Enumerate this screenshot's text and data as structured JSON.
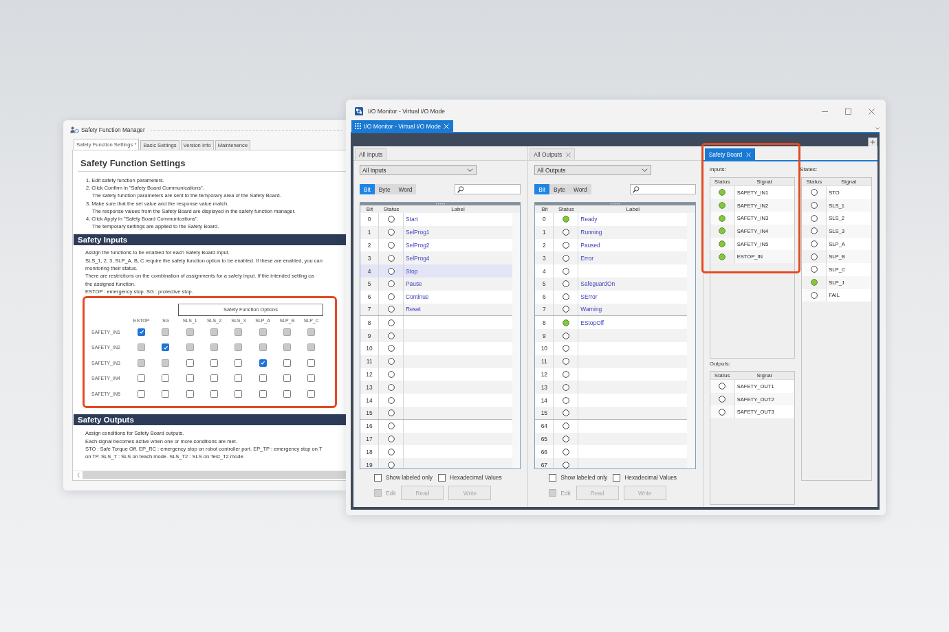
{
  "manager": {
    "title": "Safety Function Manager",
    "tabs": [
      {
        "label": "Safety Function Settings *",
        "selected": true
      },
      {
        "label": "Basic Settings",
        "selected": false
      },
      {
        "label": "Version Info",
        "selected": false
      },
      {
        "label": "Maintenence",
        "selected": false
      }
    ],
    "heading": "Safety Function Settings",
    "steps": [
      {
        "kind": "step",
        "text": "1. Edit safety function parameters."
      },
      {
        "kind": "step",
        "text": "2. Click Confirm in \"Safety Board Communications\"."
      },
      {
        "kind": "note",
        "text": "The safety function parameters are sent to the temporary area of the Safety Board."
      },
      {
        "kind": "step",
        "text": "3. Make sure that the set value and the response value match."
      },
      {
        "kind": "note",
        "text": "The response values from the Safety Board are displayed in the safety function manager."
      },
      {
        "kind": "step",
        "text": "4. Click Apply in \"Safety Board Communications\"."
      },
      {
        "kind": "note",
        "text": "The temporary settings are applied to the Safety Board."
      }
    ],
    "inputs": {
      "title": "Safety Inputs",
      "lines": [
        "Assign the functions to be enabled for each Safety Board input.",
        "SLS_1, 2, 3, SLP_A, B, C require the safety function option to be enabled. If these are enabled, you can",
        "monitoring their status.",
        "There are restrictions on the combination of assignments for a safety input. If the intended setting ca",
        "the assigned function.",
        "ESTOP : emergency stop. SG : protective stop."
      ],
      "grid": {
        "highlighted": true,
        "group_label": "Safety Function Options",
        "columns": [
          "ESTOP",
          "SG",
          "SLS_1",
          "SLS_2",
          "SLS_3",
          "SLP_A",
          "SLP_B",
          "SLP_C"
        ],
        "rows": [
          {
            "label": "SAFETY_IN1",
            "cells": [
              {
                "checked": true,
                "disabled": false
              },
              {
                "checked": false,
                "disabled": true
              },
              {
                "checked": false,
                "disabled": true
              },
              {
                "checked": false,
                "disabled": true
              },
              {
                "checked": false,
                "disabled": true
              },
              {
                "checked": false,
                "disabled": true
              },
              {
                "checked": false,
                "disabled": true
              },
              {
                "checked": false,
                "disabled": true
              }
            ]
          },
          {
            "label": "SAFETY_IN2",
            "cells": [
              {
                "checked": false,
                "disabled": true
              },
              {
                "checked": true,
                "disabled": false
              },
              {
                "checked": false,
                "disabled": true
              },
              {
                "checked": false,
                "disabled": true
              },
              {
                "checked": false,
                "disabled": true
              },
              {
                "checked": false,
                "disabled": true
              },
              {
                "checked": false,
                "disabled": true
              },
              {
                "checked": false,
                "disabled": true
              }
            ]
          },
          {
            "label": "SAFETY_IN3",
            "cells": [
              {
                "checked": false,
                "disabled": true
              },
              {
                "checked": false,
                "disabled": true
              },
              {
                "checked": false,
                "disabled": false
              },
              {
                "checked": false,
                "disabled": false
              },
              {
                "checked": false,
                "disabled": false
              },
              {
                "checked": true,
                "disabled": false
              },
              {
                "checked": false,
                "disabled": false
              },
              {
                "checked": false,
                "disabled": false
              }
            ]
          },
          {
            "label": "SAFETY_IN4",
            "cells": [
              {
                "checked": false,
                "disabled": false
              },
              {
                "checked": false,
                "disabled": false
              },
              {
                "checked": false,
                "disabled": false
              },
              {
                "checked": false,
                "disabled": false
              },
              {
                "checked": false,
                "disabled": false
              },
              {
                "checked": false,
                "disabled": false
              },
              {
                "checked": false,
                "disabled": false
              },
              {
                "checked": false,
                "disabled": false
              }
            ]
          },
          {
            "label": "SAFETY_IN5",
            "cells": [
              {
                "checked": false,
                "disabled": false
              },
              {
                "checked": false,
                "disabled": false
              },
              {
                "checked": false,
                "disabled": false
              },
              {
                "checked": false,
                "disabled": false
              },
              {
                "checked": false,
                "disabled": false
              },
              {
                "checked": false,
                "disabled": false
              },
              {
                "checked": false,
                "disabled": false
              },
              {
                "checked": false,
                "disabled": false
              }
            ]
          }
        ]
      }
    },
    "outputs": {
      "title": "Safety Outputs",
      "lines": [
        "Assign conditions for Safety Board outputs.",
        "Each signal becomes active when one or more conditions are met.",
        "STO : Safe Torque Off. EP_RC : emergency stop on robot controller port. EP_TP : emergency stop on T",
        "on TP. SLS_T : SLS on teach mode. SLS_T2 : SLS on Test_T2 mode."
      ]
    }
  },
  "monitor": {
    "title": "I/O Monitor - Virtual I/O Mode",
    "doc_tab": {
      "label": "I/O Monitor - Virtual I/O Mode",
      "selected": true
    },
    "panes": [
      {
        "kind": "io",
        "tab": {
          "label": "All Inputs",
          "selected": false,
          "closable": false
        },
        "dropdown": "All Inputs",
        "modes": [
          {
            "label": "Bit",
            "selected": true
          },
          {
            "label": "Byte",
            "selected": false
          },
          {
            "label": "Word",
            "selected": false
          }
        ],
        "columns": [
          "Bit",
          "Status",
          "Label"
        ],
        "rows": [
          {
            "bit": "0",
            "on": false,
            "label": "Start",
            "selected": false
          },
          {
            "bit": "1",
            "on": false,
            "label": "SelProg1",
            "selected": false
          },
          {
            "bit": "2",
            "on": false,
            "label": "SelProg2",
            "selected": false
          },
          {
            "bit": "3",
            "on": false,
            "label": "SelProg4",
            "selected": false
          },
          {
            "bit": "4",
            "on": false,
            "label": "Stop",
            "selected": true
          },
          {
            "bit": "5",
            "on": false,
            "label": "Pause",
            "selected": false
          },
          {
            "bit": "6",
            "on": false,
            "label": "Continue",
            "selected": false
          },
          {
            "bit": "7",
            "on": false,
            "label": "Reset",
            "selected": false
          },
          {
            "bit": "8",
            "on": false,
            "selected": false
          },
          {
            "bit": "9",
            "on": false,
            "selected": false
          },
          {
            "bit": "10",
            "on": false,
            "selected": false
          },
          {
            "bit": "11",
            "on": false,
            "selected": false
          },
          {
            "bit": "12",
            "on": false,
            "selected": false
          },
          {
            "bit": "13",
            "on": false,
            "selected": false
          },
          {
            "bit": "14",
            "on": false,
            "selected": false
          },
          {
            "bit": "15",
            "on": false,
            "selected": false
          },
          {
            "bit": "16",
            "on": false,
            "selected": false
          },
          {
            "bit": "17",
            "on": false,
            "selected": false
          },
          {
            "bit": "18",
            "on": false,
            "selected": false
          },
          {
            "bit": "19",
            "on": false,
            "selected": false
          }
        ],
        "options": [
          {
            "label": "Show labeled only",
            "checked": false
          },
          {
            "label": "Hexadecimal Values",
            "checked": false
          }
        ],
        "edit": {
          "label": "Edit",
          "checked": false,
          "disabled": true
        },
        "buttons": [
          {
            "label": "Read",
            "disabled": true
          },
          {
            "label": "Write",
            "disabled": true
          }
        ]
      },
      {
        "kind": "io",
        "tab": {
          "label": "All Outputs",
          "selected": false,
          "closable": true
        },
        "dropdown": "All Outputs",
        "modes": [
          {
            "label": "Bit",
            "selected": true
          },
          {
            "label": "Byte",
            "selected": false
          },
          {
            "label": "Word",
            "selected": false
          }
        ],
        "columns": [
          "Bit",
          "Status",
          "Label"
        ],
        "rows": [
          {
            "bit": "0",
            "on": true,
            "label": "Ready",
            "selected": false
          },
          {
            "bit": "1",
            "on": false,
            "label": "Running",
            "selected": false
          },
          {
            "bit": "2",
            "on": false,
            "label": "Paused",
            "selected": false
          },
          {
            "bit": "3",
            "on": false,
            "label": "Error",
            "selected": false
          },
          {
            "bit": "4",
            "on": false,
            "selected": false
          },
          {
            "bit": "5",
            "on": false,
            "label": "SafeguardOn",
            "selected": false
          },
          {
            "bit": "6",
            "on": false,
            "label": "SError",
            "selected": false
          },
          {
            "bit": "7",
            "on": false,
            "label": "Warning",
            "selected": false
          },
          {
            "bit": "8",
            "on": true,
            "label": "EStopOff",
            "selected": false
          },
          {
            "bit": "9",
            "on": false,
            "selected": false
          },
          {
            "bit": "10",
            "on": false,
            "selected": false
          },
          {
            "bit": "11",
            "on": false,
            "selected": false
          },
          {
            "bit": "12",
            "on": false,
            "selected": false
          },
          {
            "bit": "13",
            "on": false,
            "selected": false
          },
          {
            "bit": "14",
            "on": false,
            "selected": false
          },
          {
            "bit": "15",
            "on": false,
            "selected": false
          },
          {
            "bit": "64",
            "on": false,
            "selected": false
          },
          {
            "bit": "65",
            "on": false,
            "selected": false
          },
          {
            "bit": "66",
            "on": false,
            "selected": false
          },
          {
            "bit": "67",
            "on": false,
            "selected": false
          }
        ],
        "options": [
          {
            "label": "Show labeled only",
            "checked": false
          },
          {
            "label": "Hexadecimal Values",
            "checked": false
          }
        ],
        "edit": {
          "label": "Edit",
          "checked": false,
          "disabled": true
        },
        "buttons": [
          {
            "label": "Read",
            "disabled": true
          },
          {
            "label": "Write",
            "disabled": true
          }
        ]
      },
      {
        "kind": "safety",
        "tab": {
          "label": "Safety Board",
          "selected": true,
          "closable": true
        },
        "highlighted": true,
        "inputs": {
          "title": "Inputs:",
          "columns": [
            "Status",
            "Signal"
          ],
          "rows": [
            {
              "on": true,
              "signal": "SAFETY_IN1"
            },
            {
              "on": true,
              "signal": "SAFETY_IN2"
            },
            {
              "on": true,
              "signal": "SAFETY_IN3"
            },
            {
              "on": true,
              "signal": "SAFETY_IN4"
            },
            {
              "on": true,
              "signal": "SAFETY_IN5"
            },
            {
              "on": true,
              "signal": "ESTOP_IN"
            }
          ]
        },
        "outputs": {
          "title": "Outputs:",
          "columns": [
            "Status",
            "Signal"
          ],
          "rows": [
            {
              "on": false,
              "signal": "SAFETY_OUT1"
            },
            {
              "on": false,
              "signal": "SAFETY_OUT2"
            },
            {
              "on": false,
              "signal": "SAFETY_OUT3"
            }
          ]
        },
        "states": {
          "title": "States:",
          "columns": [
            "Status",
            "Signal"
          ],
          "rows": [
            {
              "on": false,
              "signal": "STO"
            },
            {
              "on": false,
              "signal": "SLS_1"
            },
            {
              "on": false,
              "signal": "SLS_2"
            },
            {
              "on": false,
              "signal": "SLS_3"
            },
            {
              "on": false,
              "signal": "SLP_A"
            },
            {
              "on": false,
              "signal": "SLP_B"
            },
            {
              "on": false,
              "signal": "SLP_C"
            },
            {
              "on": true,
              "signal": "SLP_J"
            },
            {
              "on": false,
              "signal": "FAIL"
            }
          ]
        }
      }
    ]
  }
}
